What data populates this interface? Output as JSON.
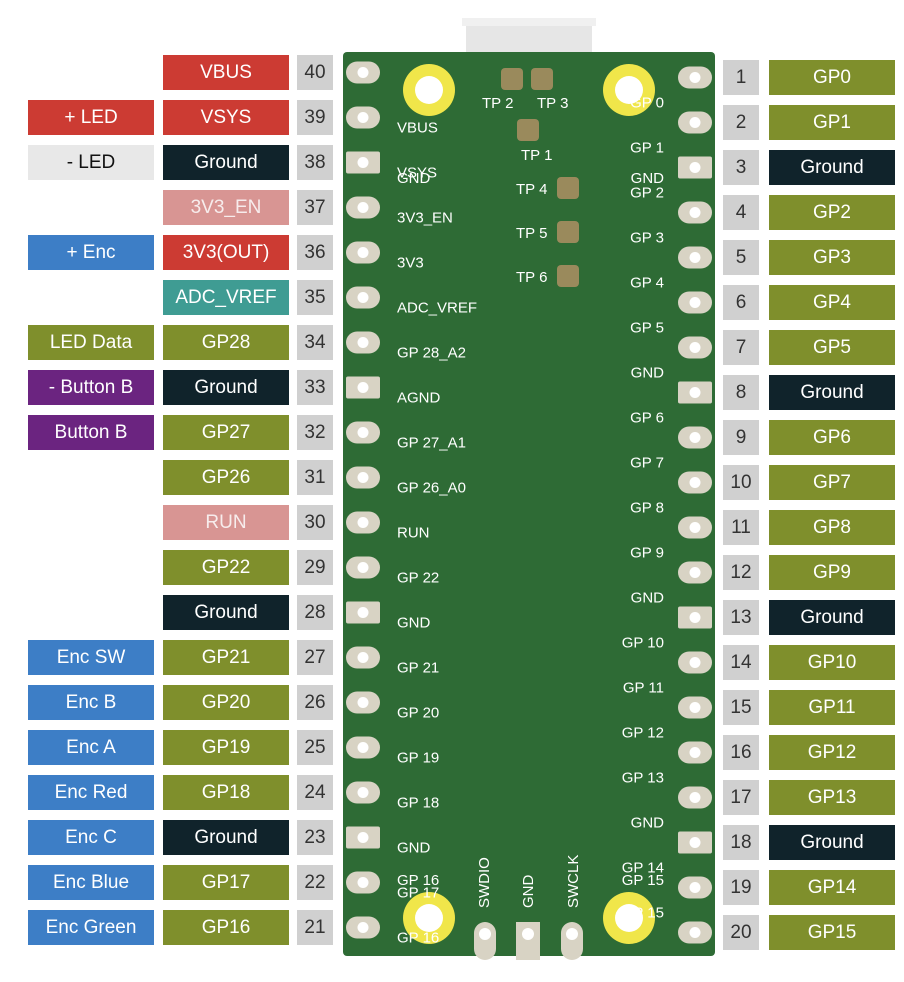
{
  "colors": {
    "power": "#cc3b33",
    "ground": "#10232b",
    "gpio": "#7f8f2c",
    "adc_vref": "#3f9c93",
    "pink": "#d89593",
    "blue": "#3d7ec6",
    "purple": "#6b2480",
    "led_neg": "#e8e8e8",
    "pin_number_bg": "#d0d0d0",
    "board": "#2e6b35",
    "testpoint": "#9a8a5c"
  },
  "left_pins": [
    {
      "num": "40",
      "label": "VBUS",
      "color": "power",
      "silk": "",
      "ext": ""
    },
    {
      "num": "39",
      "label": "VSYS",
      "color": "power",
      "silk": "VBUS",
      "ext": "+ LED",
      "ext_color": "power"
    },
    {
      "num": "38",
      "label": "Ground",
      "color": "ground",
      "silk": "VSYS",
      "ext": "- LED",
      "ext_color": "led_neg"
    },
    {
      "num": "37",
      "label": "3V3_EN",
      "color": "pink",
      "silk": "3V3_EN",
      "ext": ""
    },
    {
      "num": "36",
      "label": "3V3(OUT)",
      "color": "power",
      "silk": "3V3",
      "ext": "+ Enc",
      "ext_color": "blue"
    },
    {
      "num": "35",
      "label": "ADC_VREF",
      "color": "adc_vref",
      "silk": "ADC_VREF",
      "ext": ""
    },
    {
      "num": "34",
      "label": "GP28",
      "color": "gpio",
      "silk": "GP 28_A2",
      "ext": "LED Data",
      "ext_color": "gpio"
    },
    {
      "num": "33",
      "label": "Ground",
      "color": "ground",
      "silk": "AGND",
      "ext": "- Button B",
      "ext_color": "purple"
    },
    {
      "num": "32",
      "label": "GP27",
      "color": "gpio",
      "silk": "GP 27_A1",
      "ext": "Button B",
      "ext_color": "purple"
    },
    {
      "num": "31",
      "label": "GP26",
      "color": "gpio",
      "silk": "GP 26_A0",
      "ext": ""
    },
    {
      "num": "30",
      "label": "RUN",
      "color": "pink",
      "silk": "RUN",
      "ext": ""
    },
    {
      "num": "29",
      "label": "GP22",
      "color": "gpio",
      "silk": "GP 22",
      "ext": ""
    },
    {
      "num": "28",
      "label": "Ground",
      "color": "ground",
      "silk": "GND",
      "ext": ""
    },
    {
      "num": "27",
      "label": "GP21",
      "color": "gpio",
      "silk": "GP 21",
      "ext": "Enc SW",
      "ext_color": "blue"
    },
    {
      "num": "26",
      "label": "GP20",
      "color": "gpio",
      "silk": "GP 20",
      "ext": "Enc B",
      "ext_color": "blue"
    },
    {
      "num": "25",
      "label": "GP19",
      "color": "gpio",
      "silk": "GP 19",
      "ext": "Enc A",
      "ext_color": "blue"
    },
    {
      "num": "24",
      "label": "GP18",
      "color": "gpio",
      "silk": "GP 18",
      "ext": "Enc Red",
      "ext_color": "blue"
    },
    {
      "num": "23",
      "label": "Ground",
      "color": "ground",
      "silk": "GND",
      "ext": "Enc C",
      "ext_color": "blue"
    },
    {
      "num": "22",
      "label": "GP17",
      "color": "gpio",
      "silk": "GP 17",
      "ext": "Enc Blue",
      "ext_color": "blue"
    },
    {
      "num": "21",
      "label": "GP16",
      "color": "gpio",
      "silk": "GP 16",
      "ext": "Enc Green",
      "ext_color": "blue"
    }
  ],
  "right_pins": [
    {
      "num": "1",
      "label": "GP0",
      "color": "gpio",
      "silk": ""
    },
    {
      "num": "2",
      "label": "GP1",
      "color": "gpio",
      "silk": "GP 0"
    },
    {
      "num": "3",
      "label": "Ground",
      "color": "ground",
      "silk": "GP 1"
    },
    {
      "num": "4",
      "label": "GP2",
      "color": "gpio",
      "silk": "GP 2"
    },
    {
      "num": "5",
      "label": "GP3",
      "color": "gpio",
      "silk": "GP 3"
    },
    {
      "num": "6",
      "label": "GP4",
      "color": "gpio",
      "silk": "GP 4"
    },
    {
      "num": "7",
      "label": "GP5",
      "color": "gpio",
      "silk": "GP 5"
    },
    {
      "num": "8",
      "label": "Ground",
      "color": "ground",
      "silk": "GND"
    },
    {
      "num": "9",
      "label": "GP6",
      "color": "gpio",
      "silk": "GP 6"
    },
    {
      "num": "10",
      "label": "GP7",
      "color": "gpio",
      "silk": "GP 7"
    },
    {
      "num": "11",
      "label": "GP8",
      "color": "gpio",
      "silk": "GP 8"
    },
    {
      "num": "12",
      "label": "GP9",
      "color": "gpio",
      "silk": "GP 9"
    },
    {
      "num": "13",
      "label": "Ground",
      "color": "ground",
      "silk": "GND"
    },
    {
      "num": "14",
      "label": "GP10",
      "color": "gpio",
      "silk": "GP 10"
    },
    {
      "num": "15",
      "label": "GP11",
      "color": "gpio",
      "silk": "GP 11"
    },
    {
      "num": "16",
      "label": "GP12",
      "color": "gpio",
      "silk": "GP 12"
    },
    {
      "num": "17",
      "label": "GP13",
      "color": "gpio",
      "silk": "GP 13"
    },
    {
      "num": "18",
      "label": "Ground",
      "color": "ground",
      "silk": "GND"
    },
    {
      "num": "19",
      "label": "GP14",
      "color": "gpio",
      "silk": "GP 14"
    },
    {
      "num": "20",
      "label": "GP15",
      "color": "gpio",
      "silk": "GP 15"
    }
  ],
  "silk_extra": {
    "left_gnd_top": "GND",
    "left_bottom_gp16": "GP 16",
    "right_gnd_top": "GND",
    "right_bottom_gp15": "GP 15"
  },
  "test_points": [
    "TP 1",
    "TP 2",
    "TP 3",
    "TP 4",
    "TP 5",
    "TP 6"
  ],
  "debug_pins": [
    "SWDIO",
    "GND",
    "SWCLK"
  ]
}
